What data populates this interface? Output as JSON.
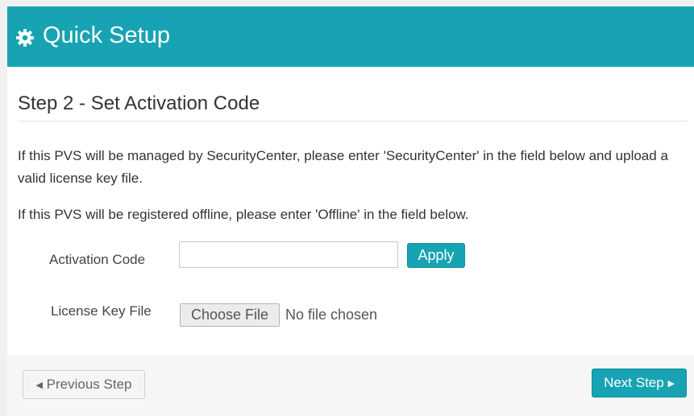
{
  "header": {
    "title": "Quick Setup",
    "icon": "gear-icon",
    "color": "#17a3b3"
  },
  "step": {
    "title": "Step 2 - Set Activation Code",
    "paragraph_1": "If this PVS will be managed by SecurityCenter, please enter 'SecurityCenter' in the field below and upload a valid license key file.",
    "paragraph_2": "If this PVS will be registered offline, please enter 'Offline' in the field below."
  },
  "form": {
    "activation_code_label": "Activation Code",
    "activation_code_value": "",
    "apply_label": "Apply",
    "license_key_label": "License Key File",
    "choose_file_label": "Choose File",
    "no_file_text": "No file chosen"
  },
  "footer": {
    "previous_label": "Previous Step",
    "next_label": "Next Step",
    "previous_icon": "caret-left-icon",
    "next_icon": "caret-right-icon"
  }
}
